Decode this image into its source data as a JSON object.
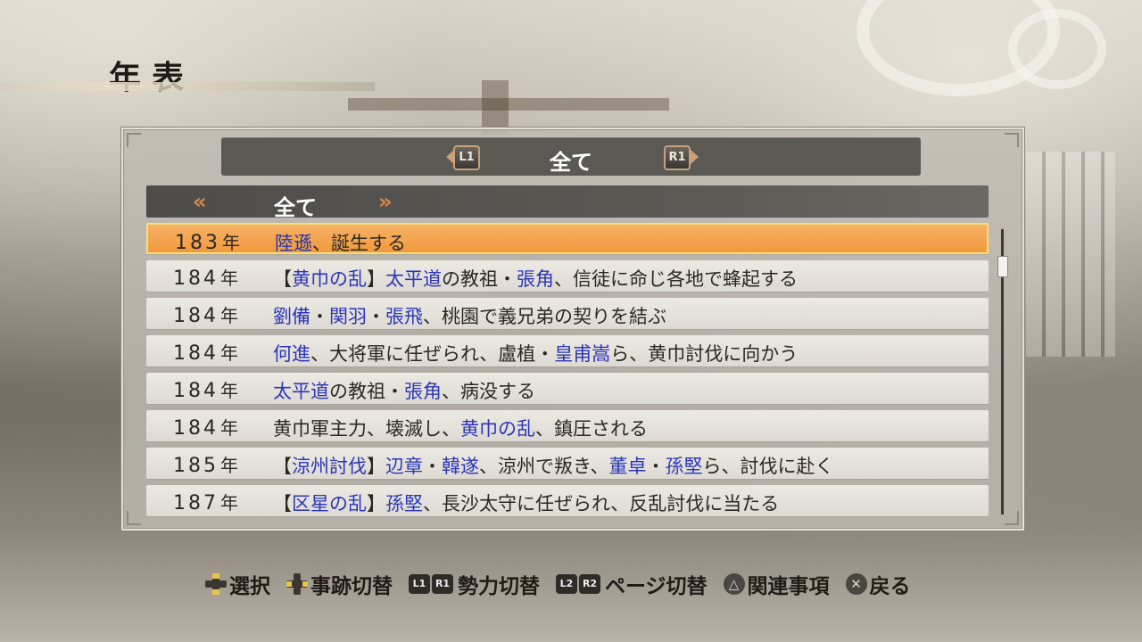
{
  "page": {
    "title": "年表"
  },
  "faction": {
    "label": "全て",
    "prev_key": "L1",
    "next_key": "R1"
  },
  "category": {
    "label": "全て",
    "prev_glyph": "«",
    "next_glyph": "»"
  },
  "events": [
    {
      "year": "183",
      "suffix": "年",
      "segments": [
        {
          "t": "陸遜",
          "hl": true
        },
        {
          "t": "、誕生する",
          "hl": false
        }
      ],
      "selected": true
    },
    {
      "year": "184",
      "suffix": "年",
      "segments": [
        {
          "t": "【",
          "hl": false
        },
        {
          "t": "黄巾の乱",
          "hl": true
        },
        {
          "t": "】",
          "hl": false
        },
        {
          "t": "太平道",
          "hl": true
        },
        {
          "t": "の教祖・",
          "hl": false
        },
        {
          "t": "張角",
          "hl": true
        },
        {
          "t": "、信徒に命じ各地で蜂起する",
          "hl": false
        }
      ]
    },
    {
      "year": "184",
      "suffix": "年",
      "segments": [
        {
          "t": "劉備",
          "hl": true
        },
        {
          "t": "・",
          "hl": false
        },
        {
          "t": "関羽",
          "hl": true
        },
        {
          "t": "・",
          "hl": false
        },
        {
          "t": "張飛",
          "hl": true
        },
        {
          "t": "、桃園で義兄弟の契りを結ぶ",
          "hl": false
        }
      ]
    },
    {
      "year": "184",
      "suffix": "年",
      "segments": [
        {
          "t": "何進",
          "hl": true
        },
        {
          "t": "、大将軍に任ぜられ、盧植・",
          "hl": false
        },
        {
          "t": "皇甫嵩",
          "hl": true
        },
        {
          "t": "ら、黄巾討伐に向かう",
          "hl": false
        }
      ]
    },
    {
      "year": "184",
      "suffix": "年",
      "segments": [
        {
          "t": "太平道",
          "hl": true
        },
        {
          "t": "の教祖・",
          "hl": false
        },
        {
          "t": "張角",
          "hl": true
        },
        {
          "t": "、病没する",
          "hl": false
        }
      ]
    },
    {
      "year": "184",
      "suffix": "年",
      "segments": [
        {
          "t": "黄巾軍主力、壊滅し、",
          "hl": false
        },
        {
          "t": "黄巾の乱",
          "hl": true
        },
        {
          "t": "、鎮圧される",
          "hl": false
        }
      ]
    },
    {
      "year": "185",
      "suffix": "年",
      "segments": [
        {
          "t": "【",
          "hl": false
        },
        {
          "t": "涼州討伐",
          "hl": true
        },
        {
          "t": "】",
          "hl": false
        },
        {
          "t": "辺章",
          "hl": true
        },
        {
          "t": "・",
          "hl": false
        },
        {
          "t": "韓遂",
          "hl": true
        },
        {
          "t": "、涼州で叛き、",
          "hl": false
        },
        {
          "t": "董卓",
          "hl": true
        },
        {
          "t": "・",
          "hl": false
        },
        {
          "t": "孫堅",
          "hl": true
        },
        {
          "t": "ら、討伐に赴く",
          "hl": false
        }
      ]
    },
    {
      "year": "187",
      "suffix": "年",
      "segments": [
        {
          "t": "【",
          "hl": false
        },
        {
          "t": "区星の乱",
          "hl": true
        },
        {
          "t": "】",
          "hl": false
        },
        {
          "t": "孫堅",
          "hl": true
        },
        {
          "t": "、長沙太守に任ぜられ、反乱討伐に当たる",
          "hl": false
        }
      ]
    }
  ],
  "scroll": {
    "position": 0.1
  },
  "footer": {
    "select": "選択",
    "switch_event": "事跡切替",
    "switch_faction": "勢力切替",
    "switch_page": "ページ切替",
    "related": "関連事項",
    "back": "戻る",
    "l1": "L1",
    "r1": "R1",
    "l2": "L2",
    "r2": "R2",
    "triangle_icon": "△",
    "cross_icon": "✕"
  },
  "colors": {
    "highlight": "#2a36b8",
    "selected_row": "#f0993c",
    "accent_arrow": "#d8894a"
  }
}
